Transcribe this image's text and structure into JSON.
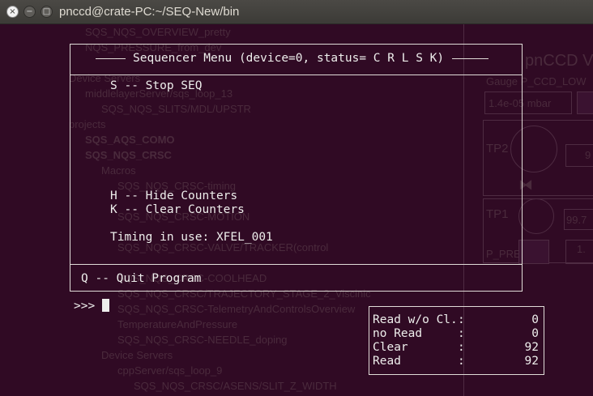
{
  "window": {
    "title": "pnccd@crate-PC:~/SEQ-New/bin",
    "buttons": {
      "close": "×",
      "minimize": "−",
      "maximize": "□"
    }
  },
  "background": {
    "items": [
      "SQS_NQS_OVERVIEW_pretty",
      "NQS_PRESSURE_from_dev",
      "Device Servers",
      "middlelayerServer/sqs_loop_13",
      "SQS_NQS_SLITS/MDL/UPSTR",
      "projects",
      "SQS_AQS_COMO",
      "SQS_NQS_CRSC",
      "Macros",
      "SQS_NQS_CRSC-timing",
      "SQS_NQS_CRSC-MOTION",
      "SQS_NQS_CRSC-VALVE/TRACKER(control",
      "SQS_NQS_CRSC-COOLHEAD",
      "SQS_NQS_CRSC/TRAJECTORY_STAGE_2_Viscinic",
      "SQS_NQS_CRSC-TelemetryAndControlsOverview",
      "TemperatureAndPressure",
      "SQS_NQS_CRSC-NEEDLE_doping",
      "Device Servers",
      "cppServer/sqs_loop_9",
      "SQS_NQS_CRSC/ASENS/SLIT_Z_WIDTH"
    ],
    "right_panel": {
      "title": "pnCCD V",
      "gauge": "Gauge P_CCD_LOW",
      "pressure": "1.4e-05 mbar",
      "tp2": "TP2",
      "tp1": "TP1",
      "tp1_value": "99.7",
      "p_pre": "P_PRE",
      "p_pre_value": "1.",
      "tp2_value": "9"
    }
  },
  "menu": {
    "header": "Sequencer Menu (device=0, status= C R L S K)",
    "options": [
      {
        "key": "S",
        "text": "S -- Stop SEQ"
      },
      {
        "key": "H",
        "text": "H -- Hide Counters"
      },
      {
        "key": "K",
        "text": "K -- Clear Counters"
      }
    ],
    "timing": "Timing in use: XFEL_001",
    "quit": "Q -- Quit Program"
  },
  "prompt": ">>>",
  "counters": [
    {
      "label": "Read w/o Cl.",
      "sep": ":",
      "value": "0"
    },
    {
      "label": "no Read",
      "sep": ":",
      "value": "0"
    },
    {
      "label": "Clear",
      "sep": ":",
      "value": "92"
    },
    {
      "label": "Read",
      "sep": ":",
      "value": "92"
    }
  ]
}
